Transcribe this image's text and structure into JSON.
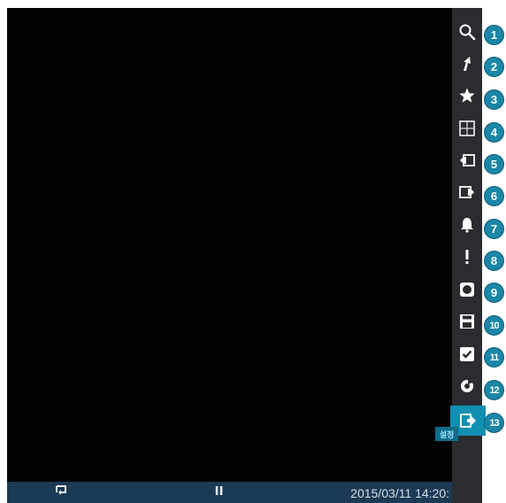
{
  "sidebar": {
    "items": [
      {
        "name": "Zoom",
        "icon": "search-icon",
        "callout": "1"
      },
      {
        "name": "Pointer",
        "icon": "pointer-icon",
        "callout": "2"
      },
      {
        "name": "Favorite",
        "icon": "star-icon",
        "callout": "3"
      },
      {
        "name": "Split screen",
        "icon": "split-screen-icon",
        "callout": "4"
      },
      {
        "name": "Previous",
        "icon": "previous-screen-icon",
        "callout": "5"
      },
      {
        "name": "Next",
        "icon": "next-screen-icon",
        "callout": "6"
      },
      {
        "name": "Alarm",
        "icon": "bell-icon",
        "callout": "7"
      },
      {
        "name": "Event",
        "icon": "exclamation-icon",
        "callout": "8"
      },
      {
        "name": "Record",
        "icon": "record-icon",
        "callout": "9"
      },
      {
        "name": "Save",
        "icon": "save-icon",
        "callout": "10"
      },
      {
        "name": "Check",
        "icon": "checkbox-icon",
        "callout": "11"
      },
      {
        "name": "Refresh",
        "icon": "refresh-icon",
        "callout": "12"
      },
      {
        "name": "Exit",
        "icon": "exit-icon",
        "callout": "13",
        "active": true
      }
    ],
    "tooltip": "설정"
  },
  "bottom_bar": {
    "left_icon": "loop-icon",
    "center_icon": "pause-icon",
    "datetime": "2015/03/11  14:20:"
  },
  "colors": {
    "accent": "#118fb3",
    "callout": "#1b86a6",
    "bottom_bar": "#1b3a55",
    "sidebar": "#2b2c2f"
  }
}
